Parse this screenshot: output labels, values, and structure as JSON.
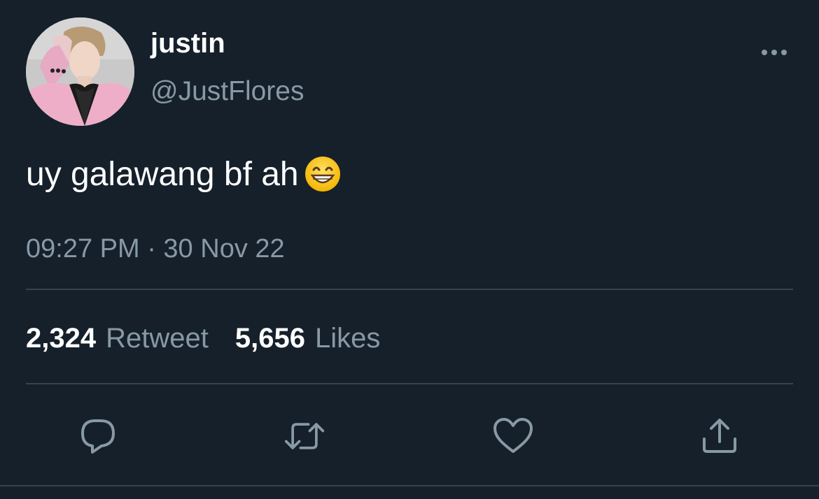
{
  "user": {
    "display_name": "justin",
    "handle": "@JustFlores",
    "avatar_icon": "profile-photo"
  },
  "tweet": {
    "text": "uy galawang bf ah",
    "emoji": "grinning-face-with-smiling-eyes",
    "timestamp": "09:27 PM · 30 Nov 22"
  },
  "stats": {
    "retweet_count": "2,324",
    "retweet_label": "Retweet",
    "like_count": "5,656",
    "like_label": "Likes"
  },
  "actions": {
    "reply_icon": "reply-icon",
    "retweet_icon": "retweet-icon",
    "like_icon": "heart-icon",
    "share_icon": "share-icon",
    "more_icon": "more-dots-icon"
  },
  "colors": {
    "background": "#15202b",
    "secondary_text": "#8899a6",
    "divider": "#38444d"
  }
}
